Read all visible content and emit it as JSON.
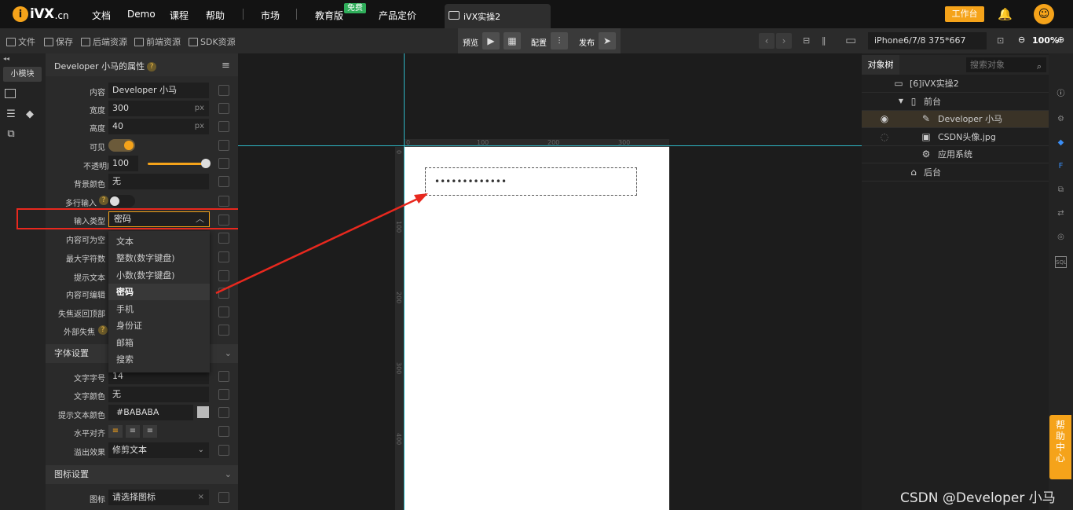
{
  "topnav": {
    "logo_text": "iVX",
    "logo_domain": ".cn",
    "links": [
      "文档",
      "Demo",
      "课程",
      "帮助",
      "市场",
      "教育版",
      "产品定价"
    ],
    "badge_free": "免费",
    "file_tab": "iVX实操2",
    "workbench": "工作台"
  },
  "toolbar": {
    "file": "文件",
    "save": "保存",
    "backend_assets": "后端资源",
    "frontend_assets": "前端资源",
    "sdk_assets": "SDK资源",
    "preview": "预览",
    "config": "配置",
    "publish": "发布",
    "device": "iPhone6/7/8 375*667",
    "zoom": "100%"
  },
  "leftstrip": {
    "module_tab": "小模块"
  },
  "props": {
    "title": "Developer 小马的属性",
    "qmark": "?",
    "labels": {
      "content": "内容",
      "width": "宽度",
      "height": "高度",
      "visible": "可见",
      "opacity": "不透明度",
      "bg_color": "背景颜色",
      "multiline": "多行输入",
      "input_type": "输入类型",
      "can_empty": "内容可为空",
      "max_chars": "最大字符数",
      "hint_text": "提示文本",
      "editable": "内容可编辑",
      "blur_top": "失焦返回顶部",
      "outer_blur": "外部失焦"
    },
    "values": {
      "content": "Developer 小马",
      "width": "300",
      "height": "40",
      "unit": "px",
      "opacity": "100 %",
      "opacity_level": 1.0,
      "bg_color": "无",
      "input_type": "密码",
      "visible_on": true,
      "multiline_on": false
    },
    "font_section": {
      "title": "字体设置",
      "font_size_label": "文字字号",
      "font_size": "14",
      "font_color_label": "文字颜色",
      "font_color": "无",
      "hint_color_label": "提示文本颜色",
      "hint_color": "#BABABA",
      "halign_label": "水平对齐",
      "overflow_label": "溢出效果",
      "overflow": "修剪文本"
    },
    "icon_section": {
      "title": "图标设置",
      "icon_label": "图标",
      "icon_placeholder": "请选择图标",
      "clear": "×"
    }
  },
  "dropdown": {
    "options": [
      "文本",
      "整数(数字键盘)",
      "小数(数字键盘)",
      "密码",
      "手机",
      "身份证",
      "邮箱",
      "搜索"
    ],
    "selected": "密码"
  },
  "canvas": {
    "ruler_top": [
      "0",
      "100",
      "200",
      "300"
    ],
    "ruler_left": [
      "0",
      "100",
      "200",
      "300",
      "400"
    ],
    "password_dots": "•••••••••••••"
  },
  "tree": {
    "tab": "对象树",
    "search_placeholder": "搜索对象",
    "items": [
      {
        "label": "[6]iVX实操2"
      },
      {
        "label": "前台"
      },
      {
        "label": "Developer 小马"
      },
      {
        "label": "CSDN头像.jpg"
      },
      {
        "label": "应用系统"
      },
      {
        "label": "后台"
      }
    ]
  },
  "help_tab": "帮助中心",
  "watermark": "CSDN @Developer 小马",
  "colors": {
    "accent": "#f5a31a",
    "highlight": "#e8281e",
    "guide": "#2fb7c5"
  }
}
